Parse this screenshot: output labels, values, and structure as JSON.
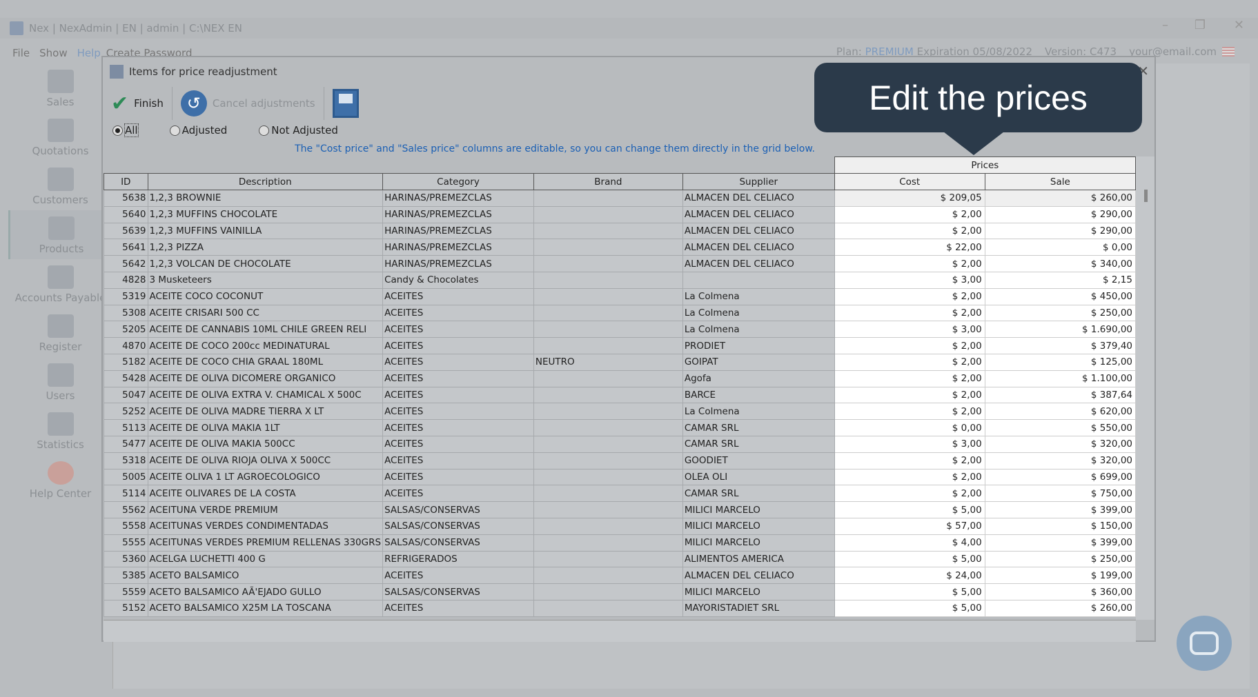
{
  "app": {
    "title": "Nex | NexAdmin | EN | admin | C:\\NEX EN"
  },
  "menu": [
    "File",
    "Show",
    "Help",
    "Create Password"
  ],
  "plan": {
    "label": "Plan:",
    "value": "PREMIUM",
    "expiration": "Expiration 05/08/2022",
    "version": "Version:  C473",
    "email": "your@email.com"
  },
  "sidebar": [
    {
      "label": "Sales"
    },
    {
      "label": "Quotations"
    },
    {
      "label": "Customers"
    },
    {
      "label": "Products"
    },
    {
      "label": "Accounts Payable"
    },
    {
      "label": "Register"
    },
    {
      "label": "Users"
    },
    {
      "label": "Statistics"
    },
    {
      "label": "Help Center"
    }
  ],
  "dialog": {
    "title": "Items for price readjustment",
    "finish": "Finish",
    "cancel": "Cancel adjustments",
    "filters": [
      "All",
      "Adjusted",
      "Not Adjusted"
    ],
    "info": "The \"Cost price\" and \"Sales price\" columns are editable, so you can change them directly in the grid below.",
    "group_header": "Prices",
    "columns": [
      "ID",
      "Description",
      "Category",
      "Brand",
      "Supplier",
      "Cost",
      "Sale"
    ],
    "rows": [
      [
        "5638",
        "1,2,3 BROWNIE",
        "HARINAS/PREMEZCLAS",
        "",
        "ALMACEN DEL CELIACO",
        "$ 209,05",
        "$ 260,00"
      ],
      [
        "5640",
        "1,2,3 MUFFINS CHOCOLATE",
        "HARINAS/PREMEZCLAS",
        "",
        "ALMACEN DEL CELIACO",
        "$ 2,00",
        "$ 290,00"
      ],
      [
        "5639",
        "1,2,3 MUFFINS VAINILLA",
        "HARINAS/PREMEZCLAS",
        "",
        "ALMACEN DEL CELIACO",
        "$ 2,00",
        "$ 290,00"
      ],
      [
        "5641",
        "1,2,3 PIZZA",
        "HARINAS/PREMEZCLAS",
        "",
        "ALMACEN DEL CELIACO",
        "$ 22,00",
        "$ 0,00"
      ],
      [
        "5642",
        "1,2,3 VOLCAN DE CHOCOLATE",
        "HARINAS/PREMEZCLAS",
        "",
        "ALMACEN DEL CELIACO",
        "$ 2,00",
        "$ 340,00"
      ],
      [
        "4828",
        "3 Musketeers",
        "Candy & Chocolates",
        "",
        "",
        "$ 3,00",
        "$ 2,15"
      ],
      [
        "5319",
        "ACEITE COCO COCONUT",
        "ACEITES",
        "",
        "La Colmena",
        "$ 2,00",
        "$ 450,00"
      ],
      [
        "5308",
        "ACEITE CRISARI 500 CC",
        "ACEITES",
        "",
        "La Colmena",
        "$ 2,00",
        "$ 250,00"
      ],
      [
        "5205",
        "ACEITE DE CANNABIS 10ML CHILE GREEN RELI",
        "ACEITES",
        "",
        "La Colmena",
        "$ 3,00",
        "$ 1.690,00"
      ],
      [
        "4870",
        "ACEITE DE COCO 200cc MEDINATURAL",
        "ACEITES",
        "",
        "PRODIET",
        "$ 2,00",
        "$ 379,40"
      ],
      [
        "5182",
        "ACEITE DE COCO CHIA GRAAL 180ML",
        "ACEITES",
        "NEUTRO",
        "GOIPAT",
        "$ 2,00",
        "$ 125,00"
      ],
      [
        "5428",
        "ACEITE DE OLIVA DICOMERE ORGANICO",
        "ACEITES",
        "",
        "Agofa",
        "$ 2,00",
        "$ 1.100,00"
      ],
      [
        "5047",
        "ACEITE DE OLIVA EXTRA V. CHAMICAL X 500C",
        "ACEITES",
        "",
        "BARCE",
        "$ 2,00",
        "$ 387,64"
      ],
      [
        "5252",
        "ACEITE DE OLIVA MADRE TIERRA X LT",
        "ACEITES",
        "",
        "La Colmena",
        "$ 2,00",
        "$ 620,00"
      ],
      [
        "5113",
        "ACEITE DE OLIVA MAKIA 1LT",
        "ACEITES",
        "",
        "CAMAR SRL",
        "$ 0,00",
        "$ 550,00"
      ],
      [
        "5477",
        "ACEITE DE OLIVA MAKIA 500CC",
        "ACEITES",
        "",
        "CAMAR SRL",
        "$ 3,00",
        "$ 320,00"
      ],
      [
        "5318",
        "ACEITE DE OLIVA RIOJA OLIVA X 500CC",
        "ACEITES",
        "",
        "GOODIET",
        "$ 2,00",
        "$ 320,00"
      ],
      [
        "5005",
        "ACEITE OLIVA 1 LT AGROECOLOGICO",
        "ACEITES",
        "",
        "OLEA OLI",
        "$ 2,00",
        "$ 699,00"
      ],
      [
        "5114",
        "ACEITE OLIVARES DE LA COSTA",
        "ACEITES",
        "",
        "CAMAR SRL",
        "$ 2,00",
        "$ 750,00"
      ],
      [
        "5562",
        "ACEITUNA VERDE PREMIUM",
        "SALSAS/CONSERVAS",
        "",
        "MILICI MARCELO",
        "$ 5,00",
        "$ 399,00"
      ],
      [
        "5558",
        "ACEITUNAS VERDES CONDIMENTADAS",
        "SALSAS/CONSERVAS",
        "",
        "MILICI MARCELO",
        "$ 57,00",
        "$ 150,00"
      ],
      [
        "5555",
        "ACEITUNAS VERDES PREMIUM RELLENAS 330GRS",
        "SALSAS/CONSERVAS",
        "",
        "MILICI MARCELO",
        "$ 4,00",
        "$ 399,00"
      ],
      [
        "5360",
        "ACELGA LUCHETTI 400 G",
        "REFRIGERADOS",
        "",
        "ALIMENTOS AMERICA",
        "$ 5,00",
        "$ 250,00"
      ],
      [
        "5385",
        "ACETO BALSAMICO",
        "ACEITES",
        "",
        "ALMACEN DEL CELIACO",
        "$ 24,00",
        "$ 199,00"
      ],
      [
        "5559",
        "ACETO BALSAMICO AÃ'EJADO GULLO",
        "SALSAS/CONSERVAS",
        "",
        "MILICI MARCELO",
        "$ 5,00",
        "$ 360,00"
      ],
      [
        "5152",
        "ACETO BALSAMICO X25M LA TOSCANA",
        "ACEITES",
        "",
        "MAYORISTADIET SRL",
        "$ 5,00",
        "$ 260,00"
      ]
    ]
  },
  "tooltip": {
    "text": "Edit the prices"
  }
}
